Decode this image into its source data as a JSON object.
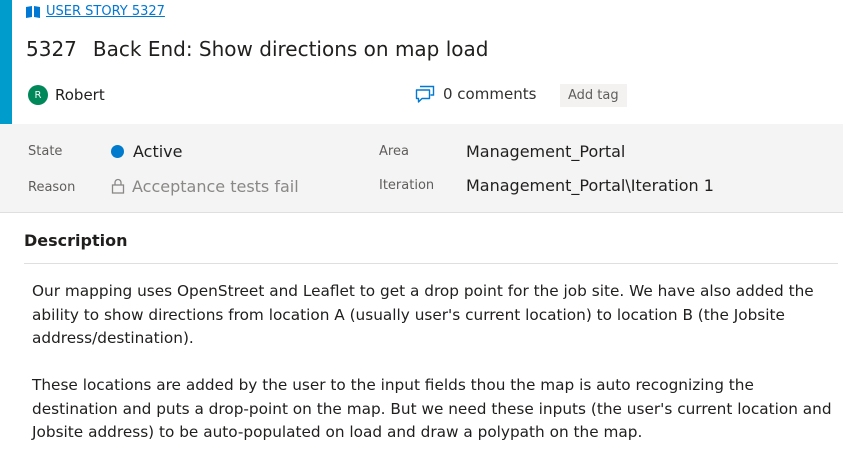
{
  "header": {
    "type_label": "USER STORY 5327",
    "work_item_id": "5327",
    "title": "Back End: Show directions on map load",
    "assignee": {
      "initial": "R",
      "name": "Robert"
    },
    "comments_label": "0 comments",
    "add_tag_label": "Add tag"
  },
  "fields": {
    "state_label": "State",
    "state_value": "Active",
    "reason_label": "Reason",
    "reason_value": "Acceptance tests fail",
    "area_label": "Area",
    "area_value": "Management_Portal",
    "iteration_label": "Iteration",
    "iteration_value": "Management_Portal\\Iteration 1"
  },
  "description": {
    "heading": "Description",
    "paragraphs": [
      "Our mapping uses OpenStreet and Leaflet to get a drop point for the job site. We have also added the ability to show directions from location A (usually user's current location) to location B (the Jobsite address/destination).",
      "These locations are added by the user to the input fields thou the map is auto recognizing the destination and puts a drop-point on the map. But we need these inputs (the user's current location and Jobsite address) to be auto-populated on load and draw a polypath on the map."
    ]
  },
  "colors": {
    "accent_bar": "#009ccc",
    "link": "#0078d4",
    "state_active": "#007acc",
    "avatar_bg": "#00875a",
    "fields_bg": "#f4f4f4"
  },
  "icons": {
    "work_item_type": "book-icon",
    "comments": "comments-icon",
    "reason": "lock-icon"
  }
}
